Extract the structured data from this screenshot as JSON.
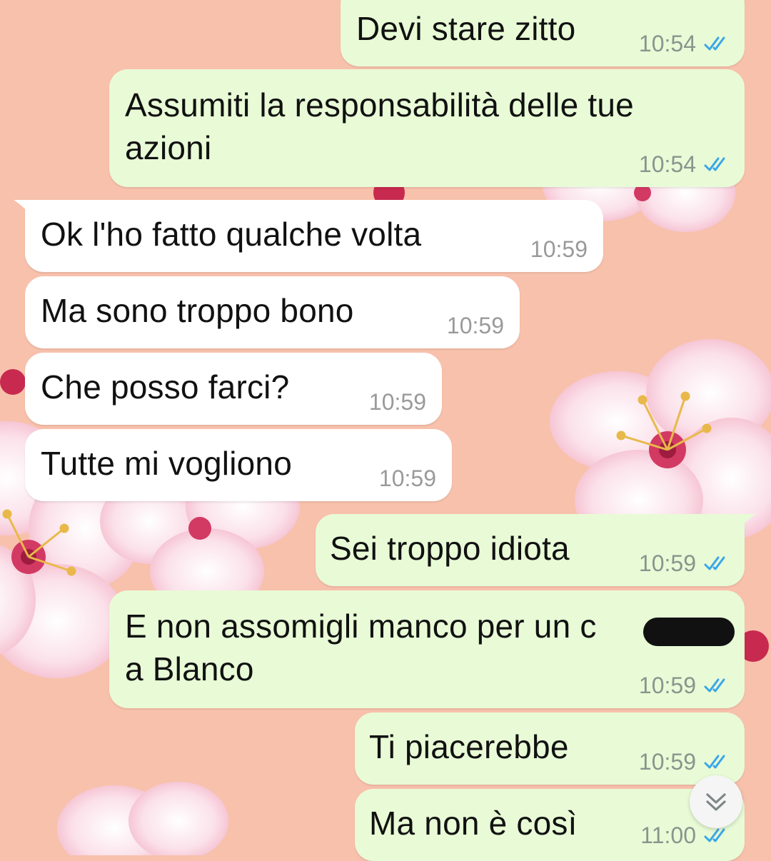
{
  "colors": {
    "background": "#f8c1ac",
    "outgoing_bubble": "#e8fbd6",
    "incoming_bubble": "#ffffff",
    "read_ticks": "#3aa6e8"
  },
  "messages": [
    {
      "direction": "outgoing",
      "text": "Devi stare zitto",
      "time": "10:54",
      "status": "read"
    },
    {
      "direction": "outgoing",
      "lines": [
        "Assumiti la responsabilità delle tue",
        "azioni"
      ],
      "time": "10:54",
      "status": "read"
    },
    {
      "direction": "incoming",
      "text": "Ok l'ho fatto qualche volta",
      "time": "10:59"
    },
    {
      "direction": "incoming",
      "text": "Ma sono troppo bono",
      "time": "10:59"
    },
    {
      "direction": "incoming",
      "text": "Che posso farci?",
      "time": "10:59"
    },
    {
      "direction": "incoming",
      "text": "Tutte mi vogliono",
      "time": "10:59"
    },
    {
      "direction": "outgoing",
      "text": "Sei troppo idiota",
      "time": "10:59",
      "status": "read"
    },
    {
      "direction": "outgoing",
      "lines": [
        "E non assomigli manco per un c",
        "a Blanco"
      ],
      "time": "10:59",
      "status": "read",
      "redacted": true
    },
    {
      "direction": "outgoing",
      "text": "Ti piacerebbe",
      "time": "10:59",
      "status": "read"
    },
    {
      "direction": "outgoing",
      "text": "Ma non è così",
      "time": "11:00",
      "status": "read"
    }
  ],
  "icons": {
    "read_receipt": "double-check-icon",
    "scroll_down": "double-chevron-down-icon"
  }
}
